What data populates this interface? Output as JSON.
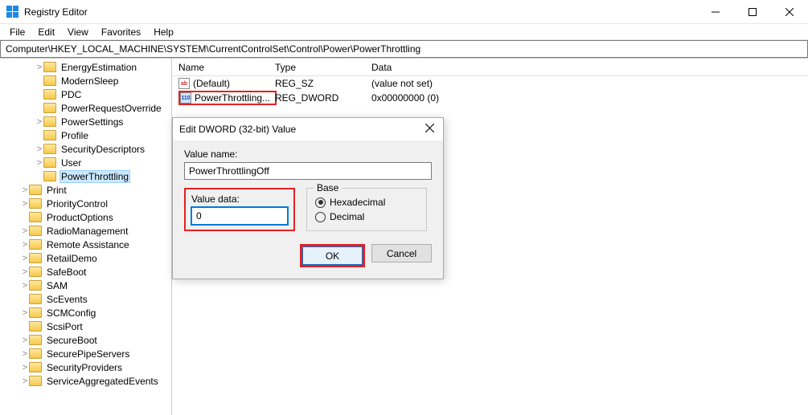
{
  "window": {
    "title": "Registry Editor"
  },
  "menu": {
    "file": "File",
    "edit": "Edit",
    "view": "View",
    "favorites": "Favorites",
    "help": "Help"
  },
  "address": "Computer\\HKEY_LOCAL_MACHINE\\SYSTEM\\CurrentControlSet\\Control\\Power\\PowerThrottling",
  "tree": [
    {
      "depth": 2,
      "chev": ">",
      "label": "EnergyEstimation"
    },
    {
      "depth": 2,
      "chev": "",
      "label": "ModernSleep"
    },
    {
      "depth": 2,
      "chev": "",
      "label": "PDC"
    },
    {
      "depth": 2,
      "chev": "",
      "label": "PowerRequestOverride"
    },
    {
      "depth": 2,
      "chev": ">",
      "label": "PowerSettings"
    },
    {
      "depth": 2,
      "chev": "",
      "label": "Profile"
    },
    {
      "depth": 2,
      "chev": ">",
      "label": "SecurityDescriptors"
    },
    {
      "depth": 2,
      "chev": ">",
      "label": "User"
    },
    {
      "depth": 2,
      "chev": "",
      "label": "PowerThrottling",
      "selected": true
    },
    {
      "depth": 1,
      "chev": ">",
      "label": "Print"
    },
    {
      "depth": 1,
      "chev": ">",
      "label": "PriorityControl"
    },
    {
      "depth": 1,
      "chev": "",
      "label": "ProductOptions"
    },
    {
      "depth": 1,
      "chev": ">",
      "label": "RadioManagement"
    },
    {
      "depth": 1,
      "chev": ">",
      "label": "Remote Assistance"
    },
    {
      "depth": 1,
      "chev": ">",
      "label": "RetailDemo"
    },
    {
      "depth": 1,
      "chev": ">",
      "label": "SafeBoot"
    },
    {
      "depth": 1,
      "chev": ">",
      "label": "SAM"
    },
    {
      "depth": 1,
      "chev": "",
      "label": "ScEvents"
    },
    {
      "depth": 1,
      "chev": ">",
      "label": "SCMConfig"
    },
    {
      "depth": 1,
      "chev": "",
      "label": "ScsiPort"
    },
    {
      "depth": 1,
      "chev": ">",
      "label": "SecureBoot"
    },
    {
      "depth": 1,
      "chev": ">",
      "label": "SecurePipeServers"
    },
    {
      "depth": 1,
      "chev": ">",
      "label": "SecurityProviders"
    },
    {
      "depth": 1,
      "chev": ">",
      "label": "ServiceAggregatedEvents"
    }
  ],
  "list": {
    "columns": {
      "name": "Name",
      "type": "Type",
      "data": "Data"
    },
    "rows": [
      {
        "icon": "str",
        "name": "(Default)",
        "type": "REG_SZ",
        "data": "(value not set)",
        "highlight": false
      },
      {
        "icon": "dword",
        "name": "PowerThrottling...",
        "type": "REG_DWORD",
        "data": "0x00000000 (0)",
        "highlight": true
      }
    ]
  },
  "dialog": {
    "title": "Edit DWORD (32-bit) Value",
    "value_name_label": "Value name:",
    "value_name": "PowerThrottlingOff",
    "value_data_label": "Value data:",
    "value_data": "0",
    "base_label": "Base",
    "hex": "Hexadecimal",
    "dec": "Decimal",
    "ok": "OK",
    "cancel": "Cancel"
  }
}
